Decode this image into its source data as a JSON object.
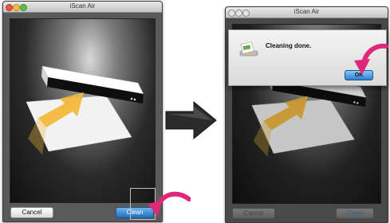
{
  "left_window": {
    "title": "iScan Air",
    "cancel_label": "Cancel",
    "clean_label": "Clean"
  },
  "right_window": {
    "title": "iScan Air",
    "cancel_label": "Cancel",
    "clean_label": "Clean"
  },
  "dialog": {
    "message": "Cleaning done.",
    "ok_label": "OK"
  },
  "colors": {
    "pointer_arrow": "#e0287a",
    "flow_arrow": "#2b2b2b",
    "feed_arrow": "#f2b83a",
    "default_button": "#2a7fd4"
  },
  "icons": [
    "scanner-illustration",
    "feed-direction-arrow",
    "flow-arrow-icon",
    "pointer-arrow-icon",
    "app-icon"
  ]
}
